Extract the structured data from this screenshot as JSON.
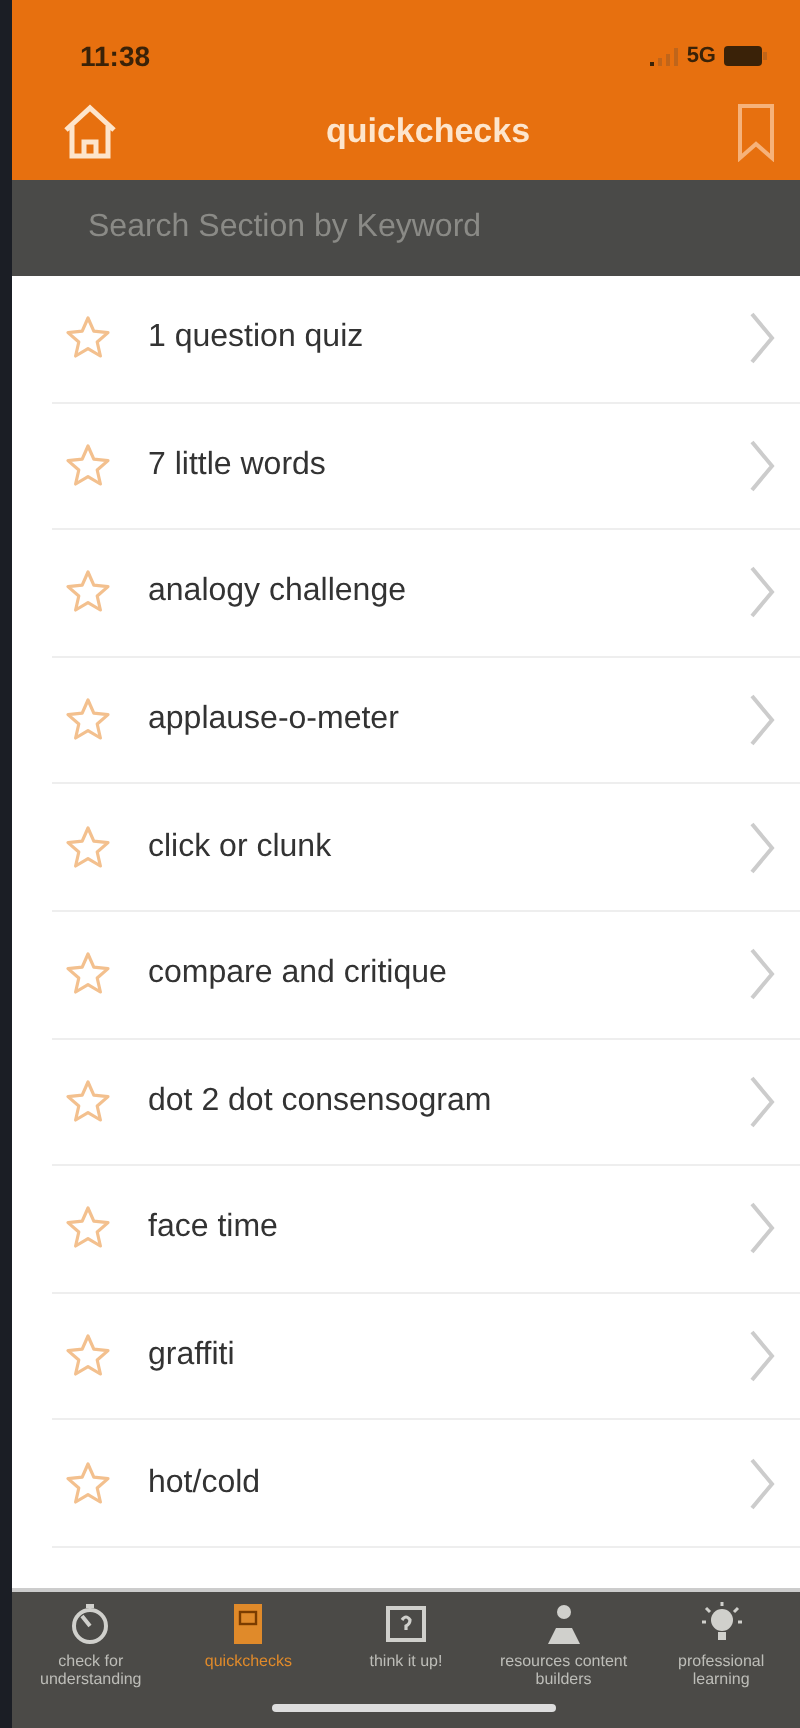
{
  "status_bar": {
    "time": "11:38",
    "network": "5G"
  },
  "header": {
    "title": "quickchecks"
  },
  "search": {
    "placeholder": "Search Section by Keyword"
  },
  "items": [
    {
      "label": "1 question quiz",
      "favorite": false
    },
    {
      "label": "7 little words",
      "favorite": false
    },
    {
      "label": "analogy challenge",
      "favorite": false
    },
    {
      "label": "applause-o-meter",
      "favorite": false
    },
    {
      "label": "click or clunk",
      "favorite": false
    },
    {
      "label": "compare and critique",
      "favorite": false
    },
    {
      "label": "dot 2 dot consensogram",
      "favorite": false
    },
    {
      "label": "face time",
      "favorite": false
    },
    {
      "label": "graffiti",
      "favorite": false
    },
    {
      "label": "hot/cold",
      "favorite": false
    }
  ],
  "tabs": [
    {
      "label": "check for understanding",
      "kind": "timer",
      "selected": false
    },
    {
      "label": "quickchecks",
      "kind": "book",
      "selected": true
    },
    {
      "label": "think it up!",
      "kind": "question",
      "selected": false
    },
    {
      "label": "resources content builders",
      "kind": "people",
      "selected": false
    },
    {
      "label": "professional learning",
      "kind": "bulb",
      "selected": false
    }
  ]
}
